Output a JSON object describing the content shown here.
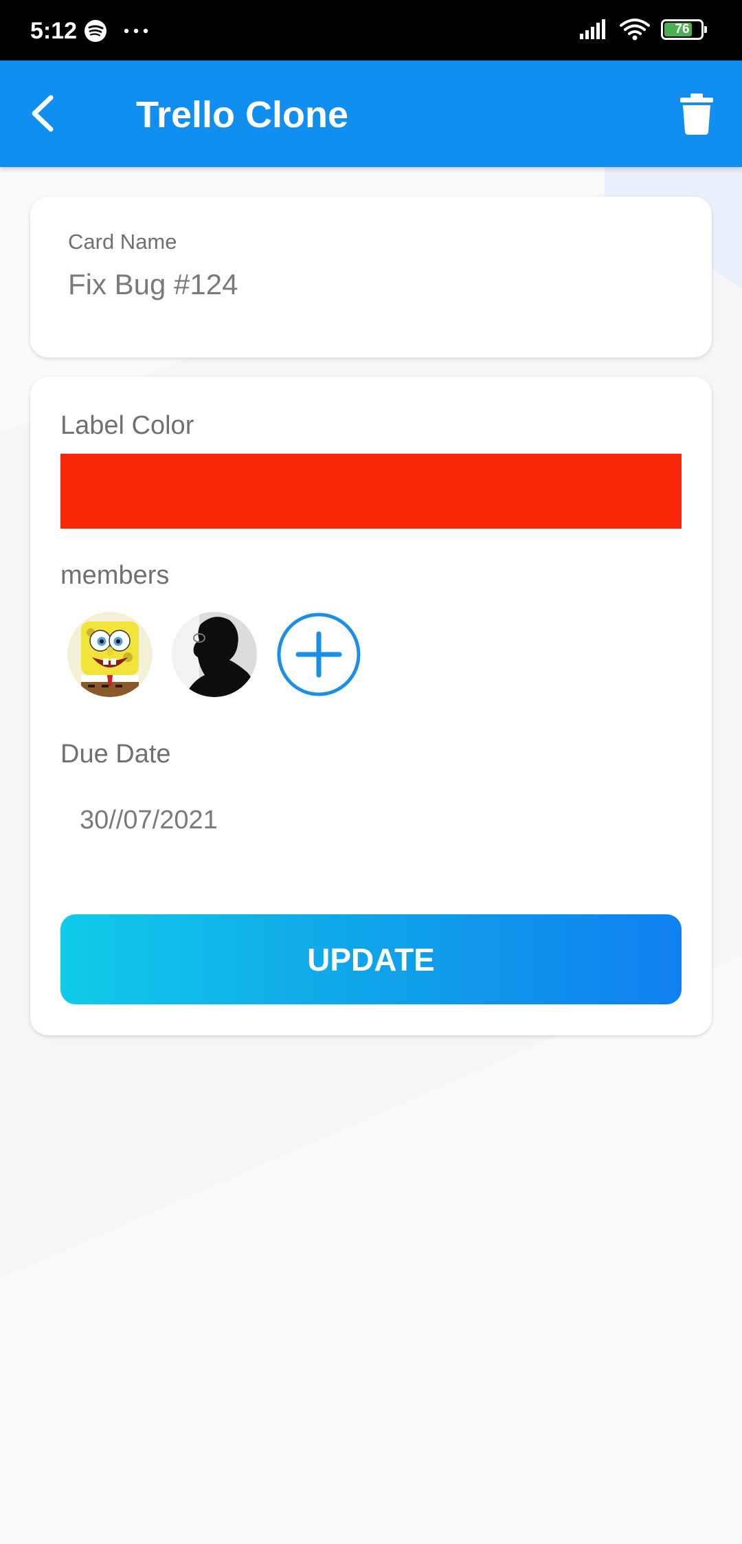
{
  "status_bar": {
    "time": "5:12",
    "battery_level": "76",
    "battery_fraction": 0.76,
    "icons": [
      "spotify-icon",
      "more-dots-icon",
      "signal-icon",
      "wifi-icon",
      "battery-icon"
    ]
  },
  "app_bar": {
    "title": "Trello Clone",
    "back_icon": "chevron-left-icon",
    "delete_icon": "trash-icon",
    "color": "#118ff0"
  },
  "card_name": {
    "label": "Card Name",
    "value": "Fix Bug #124"
  },
  "label_color": {
    "label": "Label Color",
    "color": "#f72707"
  },
  "members": {
    "label": "members",
    "items": [
      {
        "avatar": "spongebob-avatar"
      },
      {
        "avatar": "silhouette-avatar"
      }
    ],
    "add_icon": "plus-circle-icon"
  },
  "due_date": {
    "label": "Due Date",
    "value": "30//07/2021"
  },
  "update_button": {
    "label": "UPDATE",
    "gradient": [
      "#10cbe9",
      "#0f80f0"
    ]
  }
}
